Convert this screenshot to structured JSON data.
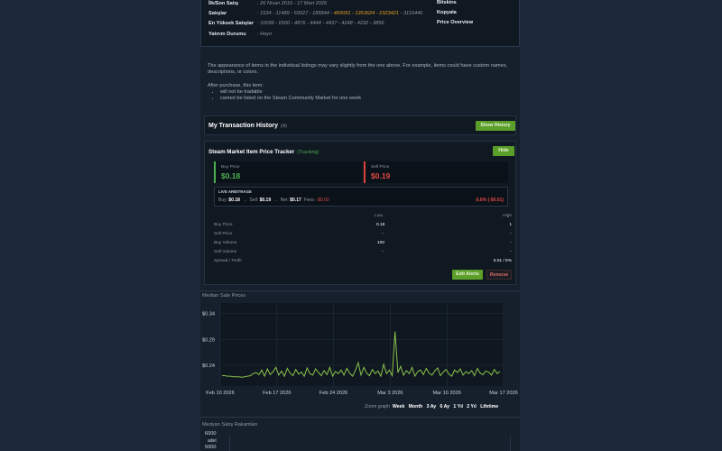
{
  "stats": {
    "first_last_label": "İlk/Son Satış",
    "first_last_value": ": 26 Nisan 2016 - 17 Mart 2026",
    "sales_label": "Satışlar",
    "sales_prefix": ": 1534 - 11489 - 50027 - 185844 - ",
    "sales_highlight": "460091 - 1353624 - 2323421",
    "sales_suffix": " - 3115446",
    "highest_label": "En Yüksek Satışlar",
    "highest_value": ": 10099 - 6500 - 4876 - 4444 - 4437 - 4248 - 4232 - 3856",
    "invest_label": "Yatırım Durumu",
    "invest_value": ": Hayır",
    "links": [
      "Bitskins",
      "Kopyala",
      "Price Overview"
    ]
  },
  "note": {
    "para": "The appearance of items in the individual listings may vary slightly from the one above. For example, items could have custom names, descriptions, or colors.",
    "after": "After purchase, this item:",
    "bullets": [
      "will not be tradable",
      "cannot be listed on the Steam Community Market for one week"
    ]
  },
  "history": {
    "title": "My Transaction History",
    "count": "(4)",
    "button": "Show History"
  },
  "tracker": {
    "title": "Steam Market Item Price Tracker",
    "status": "(Tracking)",
    "hide": "Hide",
    "buy_label": "Buy Price",
    "buy_value": "$0.18",
    "sell_label": "Sell Price",
    "sell_value": "$0.19",
    "arb_title": "LIVE ARBITRAGE",
    "arb_buy_label": "Buy:",
    "arb_buy": "$0.18",
    "arb_sell_label": "Sell:",
    "arb_sell": "$0.19",
    "arb_net_label": "Net:",
    "arb_net": "$0.17",
    "arb_fees_label": "Fees:",
    "arb_fees": "-$0.02",
    "arb_pct": "-5.6% (-$0.01)",
    "arrow": "→",
    "col_low": "Low",
    "col_high": "High",
    "rows": [
      {
        "label": "Buy Price",
        "low": "0.18",
        "high": "1"
      },
      {
        "label": "Sell Price",
        "low": "-",
        "high": "-"
      },
      {
        "label": "Buy Volume",
        "low": "100",
        "high": "-"
      },
      {
        "label": "Sell Volume",
        "low": "-",
        "high": "-"
      },
      {
        "label": "Spread / Profit",
        "low": "",
        "high": "0.01 / 5%"
      }
    ],
    "edit": "Edit Alerts",
    "remove": "Remove"
  },
  "chart_data": [
    {
      "type": "line",
      "title": "Median Sale Prices",
      "y_ticks": [
        "$0.34",
        "$0.29",
        "$0.24"
      ],
      "x_ticks": [
        "Feb 10 2026",
        "Feb 17 2026",
        "Feb 24 2026",
        "Mar 3 2026",
        "Mar 10 2026",
        "Mar 17 2026"
      ],
      "ylim": [
        0.2,
        0.36
      ],
      "series": [
        {
          "values": [
            0.22,
            0.22,
            0.219,
            0.219,
            0.218,
            0.218,
            0.218,
            0.217,
            0.218,
            0.219,
            0.22,
            0.224,
            0.226,
            0.222,
            0.231,
            0.219,
            0.233,
            0.222,
            0.228,
            0.236,
            0.221,
            0.229,
            0.219,
            0.234,
            0.225,
            0.22,
            0.232,
            0.223,
            0.227,
            0.219,
            0.235,
            0.224,
            0.221,
            0.233,
            0.226,
            0.22,
            0.23,
            0.222,
            0.236,
            0.219,
            0.228,
            0.224,
            0.231,
            0.221,
            0.234,
            0.225,
            0.219,
            0.23,
            0.245,
            0.221,
            0.236,
            0.225,
            0.22,
            0.232,
            0.224,
            0.229,
            0.219,
            0.242,
            0.224,
            0.231,
            0.22,
            0.305,
            0.226,
            0.238,
            0.221,
            0.23,
            0.224,
            0.236,
            0.219,
            0.228,
            0.231,
            0.222,
            0.234,
            0.225,
            0.221,
            0.229,
            0.235,
            0.22,
            0.227,
            0.232,
            0.223,
            0.219,
            0.231,
            0.226,
            0.233,
            0.221,
            0.228,
            0.224,
            0.23,
            0.22,
            0.234,
            0.225,
            0.222,
            0.229,
            0.227,
            0.221,
            0.232,
            0.224,
            0.228
          ]
        }
      ]
    },
    {
      "type": "bar",
      "title": "Medyan Satış Rakamları",
      "y_ticks": [
        "6000",
        "adet",
        "5000"
      ]
    }
  ],
  "zoom": {
    "label": "Zoom graph",
    "options": [
      "Week",
      "Month",
      "3 Ay",
      "6 Ay",
      "1 Yıl",
      "2 Yıl",
      "Lifetime"
    ]
  }
}
